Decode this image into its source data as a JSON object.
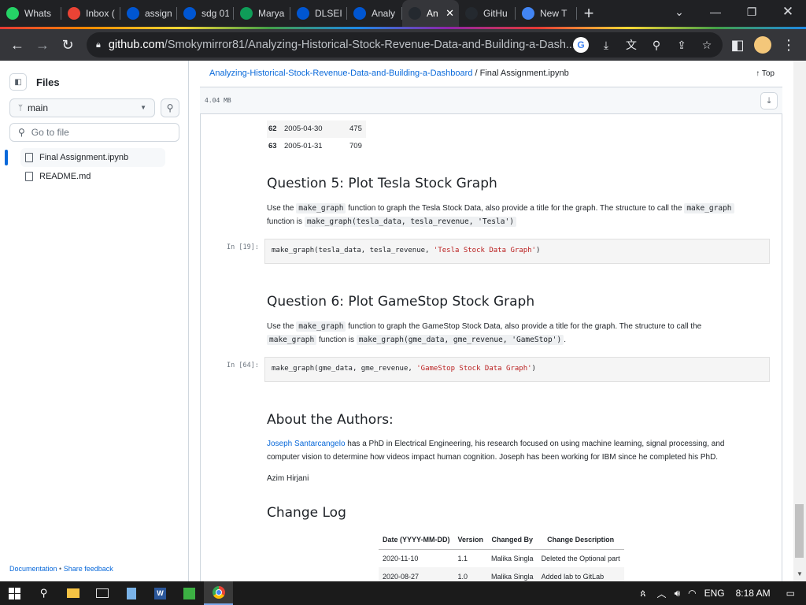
{
  "browser": {
    "tabs": [
      {
        "label": "Whats",
        "icon": "whatsapp-icon",
        "color": "#25d366"
      },
      {
        "label": "Inbox (",
        "icon": "gmail-icon",
        "color": "#ea4335"
      },
      {
        "label": "assign",
        "icon": "coursera-icon",
        "color": "#0056d2"
      },
      {
        "label": "sdg 01",
        "icon": "coursera-icon",
        "color": "#0056d2"
      },
      {
        "label": "Marya",
        "icon": "sheets-icon",
        "color": "#0f9d58"
      },
      {
        "label": "DLSEI",
        "icon": "coursera-icon",
        "color": "#0056d2"
      },
      {
        "label": "Analy",
        "icon": "coursera-icon",
        "color": "#0056d2"
      },
      {
        "label": "An",
        "icon": "github-icon",
        "color": "#24292f",
        "active": true
      },
      {
        "label": "GitHu",
        "icon": "github-icon",
        "color": "#24292f"
      },
      {
        "label": "New T",
        "icon": "chrome-icon",
        "color": "#4285f4"
      }
    ],
    "url_host": "github.com",
    "url_path": "/Smokymirror81/Analyzing-Historical-Stock-Revenue-Data-and-Building-a-Dash..."
  },
  "sidebar": {
    "title": "Files",
    "branch": "main",
    "goto_placeholder": "Go to file",
    "files": [
      "Final Assignment.ipynb",
      "README.md"
    ],
    "footer_doc": "Documentation",
    "footer_sep": " • ",
    "footer_feedback": "Share feedback"
  },
  "header": {
    "repo": "Analyzing-Historical-Stock-Revenue-Data-and-Building-a-Dashboard",
    "sep": " / ",
    "file": "Final Assignment.ipynb",
    "top_label": "Top",
    "filesize": "4.04 MB"
  },
  "notebook": {
    "table_rows": [
      {
        "idx": "62",
        "date": "2005-04-30",
        "rev": "475"
      },
      {
        "idx": "63",
        "date": "2005-01-31",
        "rev": "709"
      }
    ],
    "q5": {
      "title": "Question 5: Plot Tesla Stock Graph",
      "t1": "Use the ",
      "c1": "make_graph",
      "t2": " function to graph the Tesla Stock Data, also provide a title for the graph. The structure to call the ",
      "c2": "make_graph",
      "t3": " function is ",
      "c3": "make_graph(tesla_data, tesla_revenue, 'Tesla')",
      "prompt": "In [19]:",
      "code_pre": "make_graph(tesla_data, tesla_revenue, ",
      "code_str": "'Tesla Stock Data Graph'",
      "code_post": ")"
    },
    "q6": {
      "title": "Question 6: Plot GameStop Stock Graph",
      "t1": "Use the ",
      "c1": "make_graph",
      "t2": " function to graph the GameStop Stock Data, also provide a title for the graph. The structure to call the ",
      "c2": "make_graph",
      "t3": " function is ",
      "c3": "make_graph(gme_data, gme_revenue, 'GameStop')",
      "t4": ".",
      "prompt": "In [64]:",
      "code_pre": "make_graph(gme_data, gme_revenue, ",
      "code_str": "'GameStop Stock Data Graph'",
      "code_post": ")"
    },
    "about": {
      "title": "About the Authors:",
      "author_link": "Joseph Santarcangelo",
      "bio": " has a PhD in Electrical Engineering, his research focused on using machine learning, signal processing, and computer vision to determine how videos impact human cognition. Joseph has been working for IBM since he completed his PhD.",
      "author2": "Azim Hirjani"
    },
    "changelog": {
      "title": "Change Log",
      "headers": [
        "Date (YYYY-MM-DD)",
        "Version",
        "Changed By",
        "Change Description"
      ],
      "rows": [
        [
          "2020-11-10",
          "1.1",
          "Malika Singla",
          "Deleted the Optional part"
        ],
        [
          "2020-08-27",
          "1.0",
          "Malika Singla",
          "Added lab to GitLab"
        ]
      ]
    }
  },
  "taskbar": {
    "lang": "ENG",
    "time": "8:18 AM"
  }
}
